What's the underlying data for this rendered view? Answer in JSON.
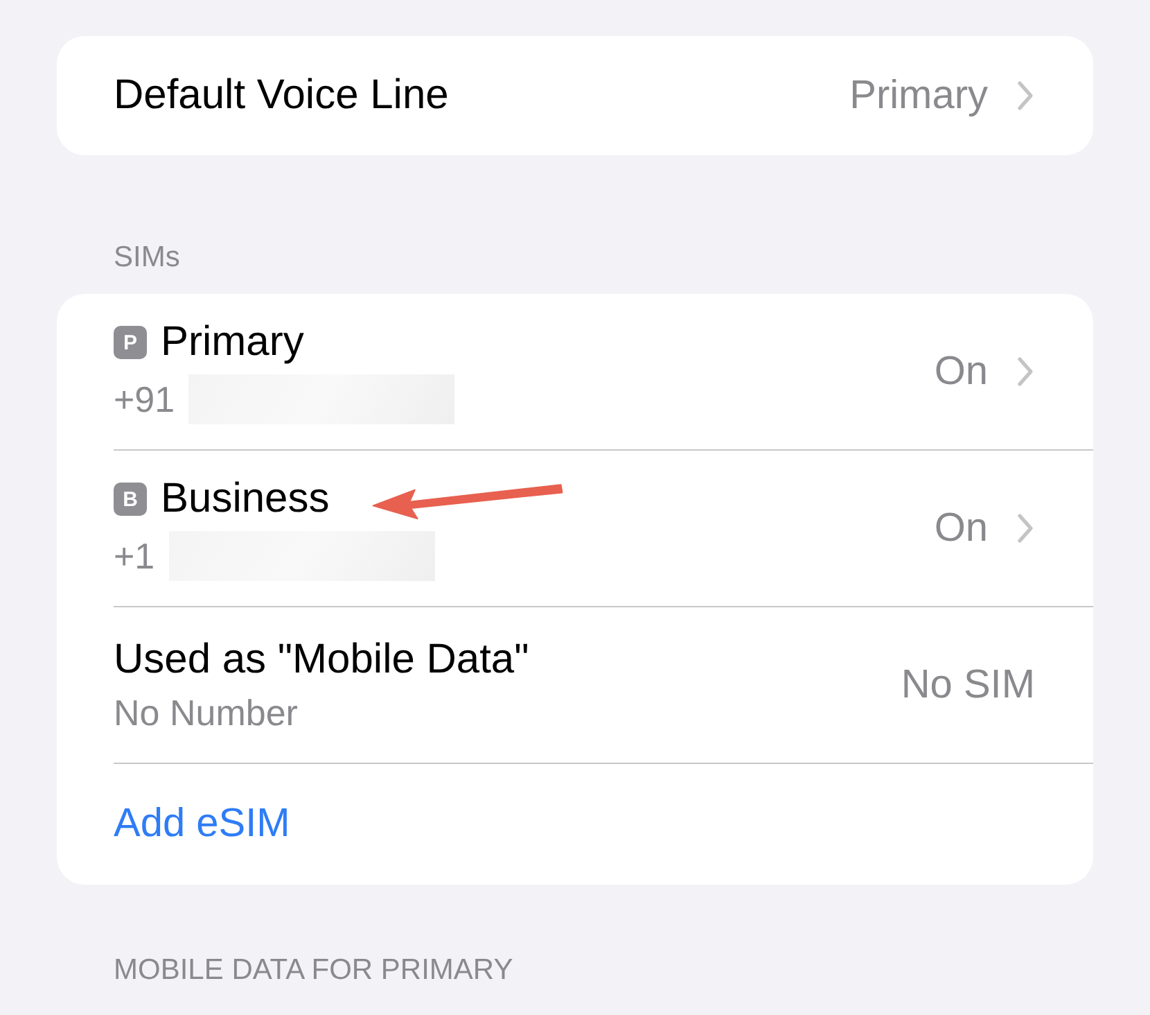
{
  "default_voice_line": {
    "label": "Default Voice Line",
    "value": "Primary",
    "chevron": true
  },
  "sims_section": {
    "header": "SIMs",
    "rows": [
      {
        "kind": "sim",
        "badge": "P",
        "title": "Primary",
        "subtitle": "+91",
        "redacted": true,
        "value": "On",
        "chevron": true,
        "annotated": false
      },
      {
        "kind": "sim",
        "badge": "B",
        "title": "Business",
        "subtitle": "+1",
        "redacted": true,
        "value": "On",
        "chevron": true,
        "annotated": true
      },
      {
        "kind": "plain",
        "title": "Used as \"Mobile Data\"",
        "subtitle": "No Number",
        "value": "No SIM",
        "chevron": false
      },
      {
        "kind": "link",
        "title": "Add eSIM"
      }
    ]
  },
  "next_section": {
    "header": "MOBILE DATA FOR PRIMARY"
  }
}
